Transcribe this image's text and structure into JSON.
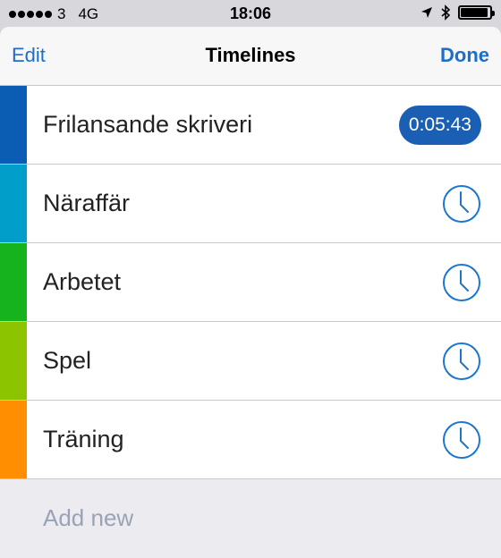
{
  "status_bar": {
    "carrier": "3",
    "network": "4G",
    "time": "18:06",
    "battery_level": 0.95
  },
  "nav": {
    "edit_label": "Edit",
    "title": "Timelines",
    "done_label": "Done"
  },
  "timelines": [
    {
      "label": "Frilansande skriveri",
      "color": "#0b5cb3",
      "timer": "0:05:43",
      "running": true,
      "icon": "clock-icon"
    },
    {
      "label": "Näraffär",
      "color": "#009ec8",
      "running": false,
      "icon": "clock-icon"
    },
    {
      "label": "Arbetet",
      "color": "#16b31f",
      "running": false,
      "icon": "clock-icon"
    },
    {
      "label": "Spel",
      "color": "#8cc400",
      "running": false,
      "icon": "clock-icon"
    },
    {
      "label": "Träning",
      "color": "#ff8f00",
      "running": false,
      "icon": "clock-icon"
    }
  ],
  "add_new": {
    "label": "Add new"
  },
  "colors": {
    "accent": "#1c6ec8",
    "badge": "#1a5fb4",
    "clock": "#1a76d2"
  }
}
